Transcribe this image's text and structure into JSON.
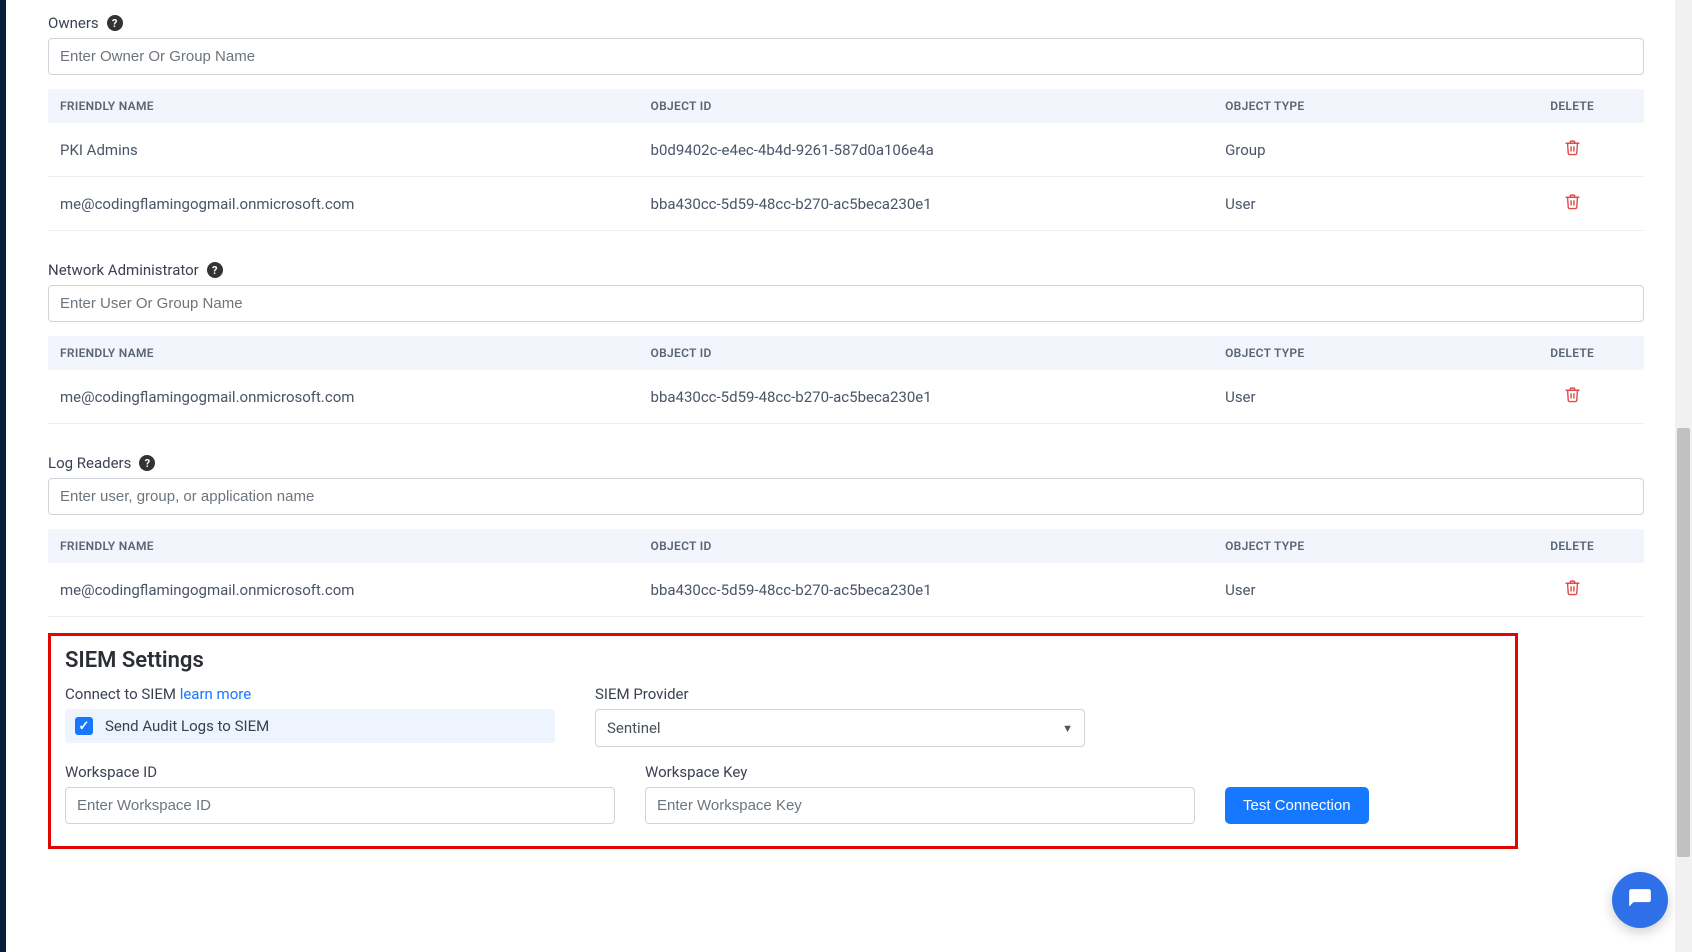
{
  "owners": {
    "label": "Owners",
    "placeholder": "Enter Owner Or Group Name",
    "headers": {
      "name": "FRIENDLY NAME",
      "objId": "OBJECT ID",
      "objType": "OBJECT TYPE",
      "delete": "DELETE"
    },
    "rows": [
      {
        "name": "PKI Admins",
        "objId": "b0d9402c-e4ec-4b4d-9261-587d0a106e4a",
        "objType": "Group"
      },
      {
        "name": "me@codingflamingogmail.onmicrosoft.com",
        "objId": "bba430cc-5d59-48cc-b270-ac5beca230e1",
        "objType": "User"
      }
    ]
  },
  "netadmin": {
    "label": "Network Administrator",
    "placeholder": "Enter User Or Group Name",
    "headers": {
      "name": "FRIENDLY NAME",
      "objId": "OBJECT ID",
      "objType": "OBJECT TYPE",
      "delete": "DELETE"
    },
    "rows": [
      {
        "name": "me@codingflamingogmail.onmicrosoft.com",
        "objId": "bba430cc-5d59-48cc-b270-ac5beca230e1",
        "objType": "User"
      }
    ]
  },
  "logReaders": {
    "label": "Log Readers",
    "placeholder": "Enter user, group, or application name",
    "headers": {
      "name": "FRIENDLY NAME",
      "objId": "OBJECT ID",
      "objType": "OBJECT TYPE",
      "delete": "DELETE"
    },
    "rows": [
      {
        "name": "me@codingflamingogmail.onmicrosoft.com",
        "objId": "bba430cc-5d59-48cc-b270-ac5beca230e1",
        "objType": "User"
      }
    ]
  },
  "siem": {
    "heading": "SIEM Settings",
    "connectLabel": "Connect to SIEM ",
    "learnMore": "learn more",
    "checkboxLabel": "Send Audit Logs to SIEM",
    "providerLabel": "SIEM Provider",
    "providerValue": "Sentinel",
    "workspaceIdLabel": "Workspace ID",
    "workspaceIdPlaceholder": "Enter Workspace ID",
    "workspaceKeyLabel": "Workspace Key",
    "workspaceKeyPlaceholder": "Enter Workspace Key",
    "testBtn": "Test Connection"
  }
}
